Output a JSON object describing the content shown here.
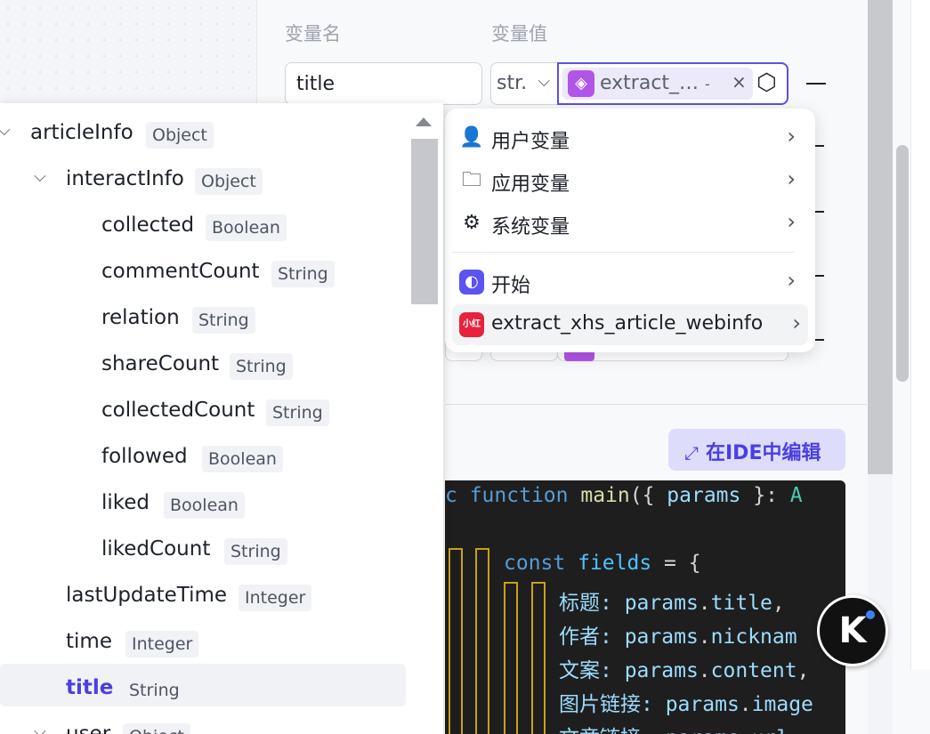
{
  "form": {
    "col_name": "变量名",
    "col_value": "变量值",
    "name_value": "title",
    "type_value": "str.",
    "value_chip": "extract_…",
    "value_chip_dash": "-",
    "clear_icon": "×"
  },
  "menu": {
    "items": [
      {
        "label": "用户变量",
        "icon": "user-icon"
      },
      {
        "label": "应用变量",
        "icon": "folder-icon"
      },
      {
        "label": "系统变量",
        "icon": "gear-icon"
      },
      {
        "label": "开始",
        "icon": "start-node-icon"
      },
      {
        "label": "extract_xhs_article_webinfo",
        "icon": "xiaohongshu-icon",
        "icon_text": "小红书"
      }
    ]
  },
  "ide_button": {
    "label": "在IDE中编辑",
    "icon": "expand-icon"
  },
  "code": {
    "l1": {
      "a": "c ",
      "b": "function",
      "c": " ",
      "d": "main",
      "e": "({ ",
      "f": "params",
      "g": " }: ",
      "h": "A"
    },
    "l2": {
      "a": "const",
      "b": " ",
      "c": "fields",
      "d": " = {"
    },
    "l3": {
      "k": "标题: ",
      "v": "params",
      "p": ".",
      "w": "title",
      "e": ","
    },
    "l4": {
      "k": "作者: ",
      "v": "params",
      "p": ".",
      "w": "nicknam"
    },
    "l5": {
      "k": "文案: ",
      "v": "params",
      "p": ".",
      "w": "content",
      "e": ","
    },
    "l6": {
      "k": "图片链接: ",
      "v": "params",
      "p": ".",
      "w": "image"
    },
    "l7": {
      "k": "文章链接: ",
      "v": "params",
      "p": ".",
      "w": "url"
    }
  },
  "tree": {
    "nodes": [
      {
        "name": "articleInfo",
        "type": "Object",
        "expanded": true
      },
      {
        "name": "interactInfo",
        "type": "Object",
        "expanded": true
      },
      {
        "name": "collected",
        "type": "Boolean"
      },
      {
        "name": "commentCount",
        "type": "String"
      },
      {
        "name": "relation",
        "type": "String"
      },
      {
        "name": "shareCount",
        "type": "String"
      },
      {
        "name": "collectedCount",
        "type": "String"
      },
      {
        "name": "followed",
        "type": "Boolean"
      },
      {
        "name": "liked",
        "type": "Boolean"
      },
      {
        "name": "likedCount",
        "type": "String"
      },
      {
        "name": "lastUpdateTime",
        "type": "Integer"
      },
      {
        "name": "time",
        "type": "Integer"
      },
      {
        "name": "title",
        "type": "String",
        "selected": true
      },
      {
        "name": "user",
        "type": "Object",
        "expanded": true
      }
    ]
  },
  "fab": {
    "label": "K"
  },
  "colors": {
    "accent": "#5c50e6",
    "selected_text": "#4a3fe0",
    "code_bg": "#1e1e1e",
    "xhs_red": "#e8223a"
  }
}
